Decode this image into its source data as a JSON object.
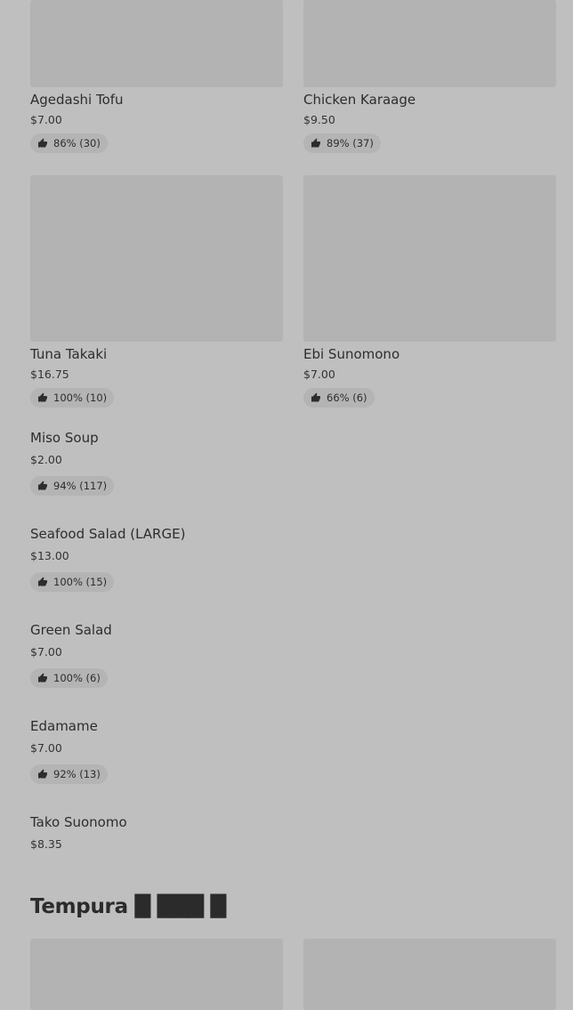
{
  "grid_cards": [
    {
      "name": "Agedashi Tofu",
      "price": "$7.00",
      "rating": "86% (30)"
    },
    {
      "name": "Chicken Karaage",
      "price": "$9.50",
      "rating": "89% (37)"
    },
    {
      "name": "Tuna Takaki",
      "price": "$16.75",
      "rating": "100% (10)"
    },
    {
      "name": "Ebi Sunomono",
      "price": "$7.00",
      "rating": "66% (6)"
    }
  ],
  "list_items": [
    {
      "name": "Miso Soup",
      "price": "$2.00",
      "rating": "94% (117)"
    },
    {
      "name": "Seafood Salad (LARGE)",
      "price": "$13.00",
      "rating": "100% (15)"
    },
    {
      "name": "Green Salad",
      "price": "$7.00",
      "rating": "100% (6)"
    },
    {
      "name": "Edamame",
      "price": "$7.00",
      "rating": "92% (13)"
    },
    {
      "name": "Tako Suonomo",
      "price": "$8.35"
    }
  ],
  "section": {
    "title": "Tempura █ ███ █"
  },
  "colors": {
    "page_background": "#bfbfbf",
    "image_placeholder": "#b3b3b3",
    "badge_background": "#b4b4b4"
  },
  "icons": {
    "rating": "thumbs-up-icon"
  }
}
